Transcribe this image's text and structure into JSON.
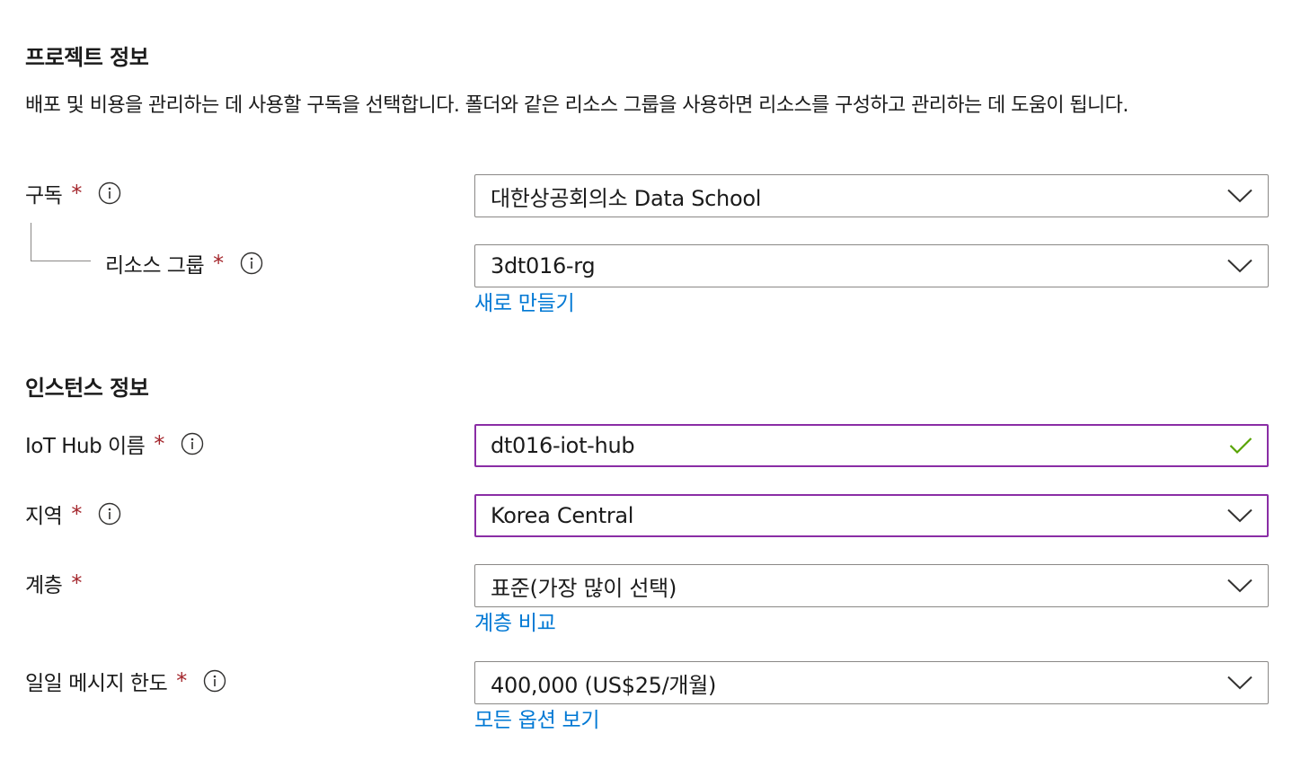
{
  "project_section": {
    "title": "프로젝트 정보",
    "description": "배포 및 비용을 관리하는 데 사용할 구독을 선택합니다. 폴더와 같은 리소스 그룹을 사용하면 리소스를 구성하고 관리하는 데 도움이 됩니다.",
    "subscription": {
      "label": "구독",
      "required": "*",
      "value": "대한상공회의소 Data School"
    },
    "resource_group": {
      "label": "리소스 그룹",
      "required": "*",
      "value": "3dt016-rg",
      "link": "새로 만들기"
    }
  },
  "instance_section": {
    "title": "인스턴스 정보",
    "iot_hub_name": {
      "label": "IoT Hub 이름",
      "required": "*",
      "value": "dt016-iot-hub",
      "valid": true
    },
    "region": {
      "label": "지역",
      "required": "*",
      "value": "Korea Central"
    },
    "tier": {
      "label": "계층",
      "required": "*",
      "value": "표준(가장 많이 선택)",
      "link": "계층 비교"
    },
    "daily_message_limit": {
      "label": "일일 메시지 한도",
      "required": "*",
      "value": "400,000 (US$25/개월)",
      "link": "모든 옵션 보기"
    }
  },
  "icons": {
    "info": "info-circle-icon",
    "dropdown": "chevron-down-icon",
    "valid": "checkmark-icon"
  },
  "colors": {
    "required": "#a4262c",
    "link": "#0078d4",
    "focus_border": "#8a2da5",
    "valid_check": "#57a300",
    "border": "#8a8886"
  }
}
